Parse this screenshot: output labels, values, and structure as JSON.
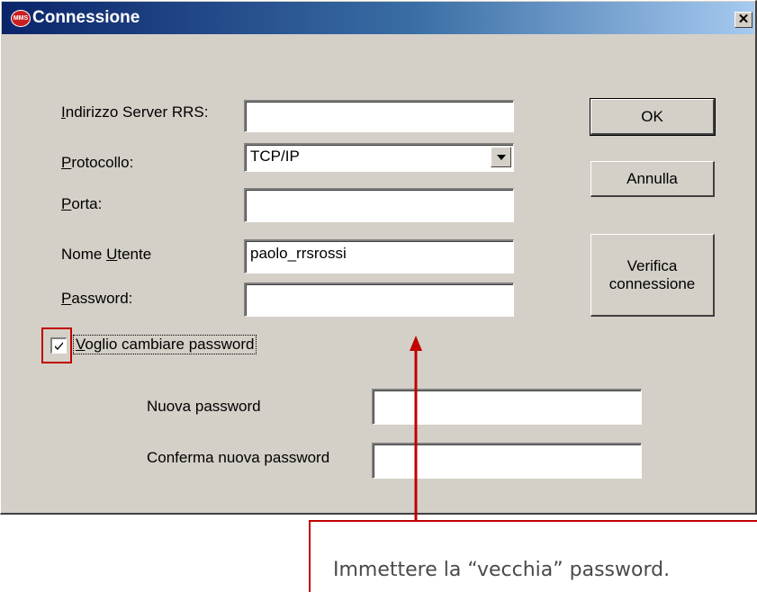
{
  "window": {
    "title": "Connessione",
    "close_glyph": "✕",
    "app_icon_text": "MMS"
  },
  "form": {
    "server_label": "Indirizzo Server RRS:",
    "server_value": "",
    "protocol_label": "Protocollo:",
    "protocol_value": "TCP/IP",
    "port_label": "Porta:",
    "port_value": "",
    "username_label": "Nome Utente",
    "username_value": "paolo_rrsrossi",
    "password_label": "Password:",
    "password_value": "",
    "change_password_label": "Voglio cambiare password",
    "change_password_checked": true,
    "new_password_label": "Nuova password",
    "new_password_value": "",
    "confirm_password_label": "Conferma nuova password",
    "confirm_password_value": ""
  },
  "buttons": {
    "ok": "OK",
    "cancel": "Annulla",
    "verify_line1": "Verifica",
    "verify_line2": "connessione"
  },
  "annotation": {
    "callout_text": "Immettere la “vecchia” password.",
    "accent_color": "#c00000"
  }
}
